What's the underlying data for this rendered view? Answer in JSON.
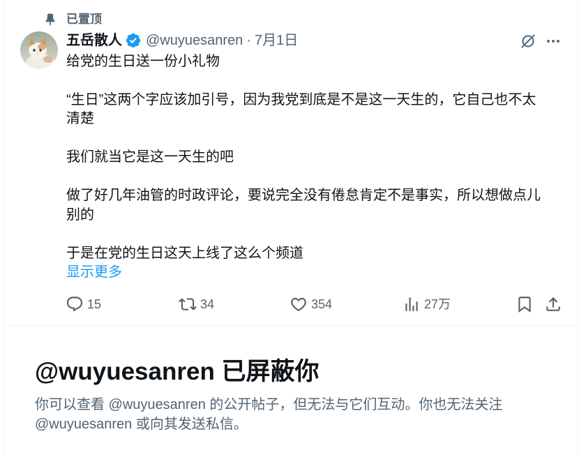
{
  "pinned": {
    "icon": "pin-icon",
    "label": "已置顶"
  },
  "tweet": {
    "author": {
      "avatar": "cat-photo-avatar",
      "name": "五岳散人",
      "verified_icon": "verified-badge-icon",
      "handle": "@wuyuesanren"
    },
    "separator": "·",
    "date": "7月1日",
    "header_icons": {
      "grok": "grok-icon",
      "more": "more-icon"
    },
    "paragraphs": [
      {
        "lines": [
          "给党的生日送一份小礼物"
        ]
      },
      {
        "lines": [
          "“生日”这两个字应该加引号，因为我党到底是不是这一天生的，它自己也不太",
          "清楚"
        ]
      },
      {
        "lines": [
          "我们就当它是这一天生的吧"
        ]
      },
      {
        "lines": [
          "做了好几年油管的时政评论，要说完全没有倦怠肯定不是事实，所以想做点儿",
          "别的"
        ]
      },
      {
        "lines": [
          "于是在党的生日这天上线了这么个频道"
        ]
      }
    ],
    "show_more": "显示更多",
    "actions": {
      "reply": {
        "icon": "reply-icon",
        "count": "15"
      },
      "repost": {
        "icon": "repost-icon",
        "count": "34"
      },
      "like": {
        "icon": "heart-icon",
        "count": "354"
      },
      "views": {
        "icon": "views-icon",
        "count": "27万"
      },
      "bookmark": {
        "icon": "bookmark-icon"
      },
      "share": {
        "icon": "share-icon"
      }
    }
  },
  "blocked_notice": {
    "title": "@wuyuesanren 已屏蔽你",
    "description_lines": [
      "你可以查看 @wuyuesanren 的公开帖子，但无法与它们互动。你也无法关注",
      "@wuyuesanren 或向其发送私信。"
    ]
  },
  "colors": {
    "text_primary": "#0f1419",
    "text_secondary": "#536471",
    "accent_blue": "#1d9bf0",
    "border": "#eff3f4",
    "background": "#ffffff"
  }
}
